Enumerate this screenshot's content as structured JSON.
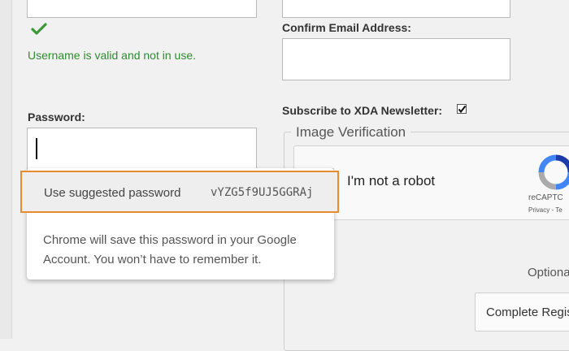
{
  "form": {
    "username_valid_message": "Username is valid and not in use.",
    "confirm_email_label": "Confirm Email Address:",
    "password_label": "Password:",
    "newsletter_label": "Subscribe to XDA Newsletter:",
    "newsletter_checked": true,
    "image_verification_legend": "Image Verification",
    "optional_text": "Optiona",
    "complete_button": "Complete Regis"
  },
  "recaptcha": {
    "label": "I'm not a robot",
    "brand": "reCAPTC",
    "links": "Privacy - Te"
  },
  "password_suggestion": {
    "action_label": "Use suggested password",
    "suggested_password": "vYZG5f9UJ5GGRAj",
    "info_text": "Chrome will save this password in your Google Account. You won’t have to remember it.",
    "highlight_color": "#e88a2e"
  },
  "icons": {
    "valid": "checkmark-icon",
    "recaptcha": "recaptcha-logo-icon"
  }
}
